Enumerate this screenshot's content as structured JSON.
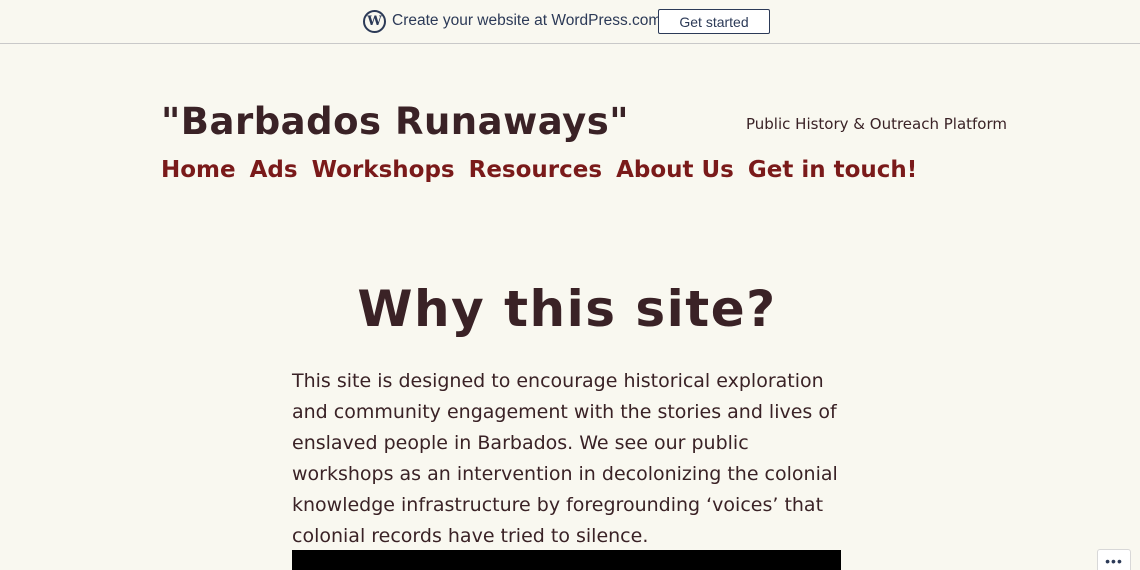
{
  "wp_bar": {
    "logo_glyph": "W",
    "promo_text": "Create your website at WordPress.com",
    "cta_label": "Get started"
  },
  "site": {
    "title": "\"Barbados Runaways\"",
    "tagline": "Public History & Outreach Platform"
  },
  "nav": {
    "items": [
      {
        "label": "Home"
      },
      {
        "label": "Ads"
      },
      {
        "label": "Workshops"
      },
      {
        "label": "Resources"
      },
      {
        "label": "About Us"
      },
      {
        "label": "Get in touch!"
      }
    ]
  },
  "main": {
    "heading": "Why this site?",
    "paragraph": "This site is designed to encourage historical exploration and community engagement with the stories and lives of enslaved people in Barbados. We see our public workshops as an intervention in decolonizing the colonial knowledge infrastructure by foregrounding ‘voices’ that colonial records have tried to silence."
  },
  "floating": {
    "more_glyph": "•••"
  },
  "colors": {
    "background": "#f9f8f0",
    "text": "#3a2226",
    "nav_link": "#7a1a1a",
    "wp_blue": "#2c3a57"
  }
}
